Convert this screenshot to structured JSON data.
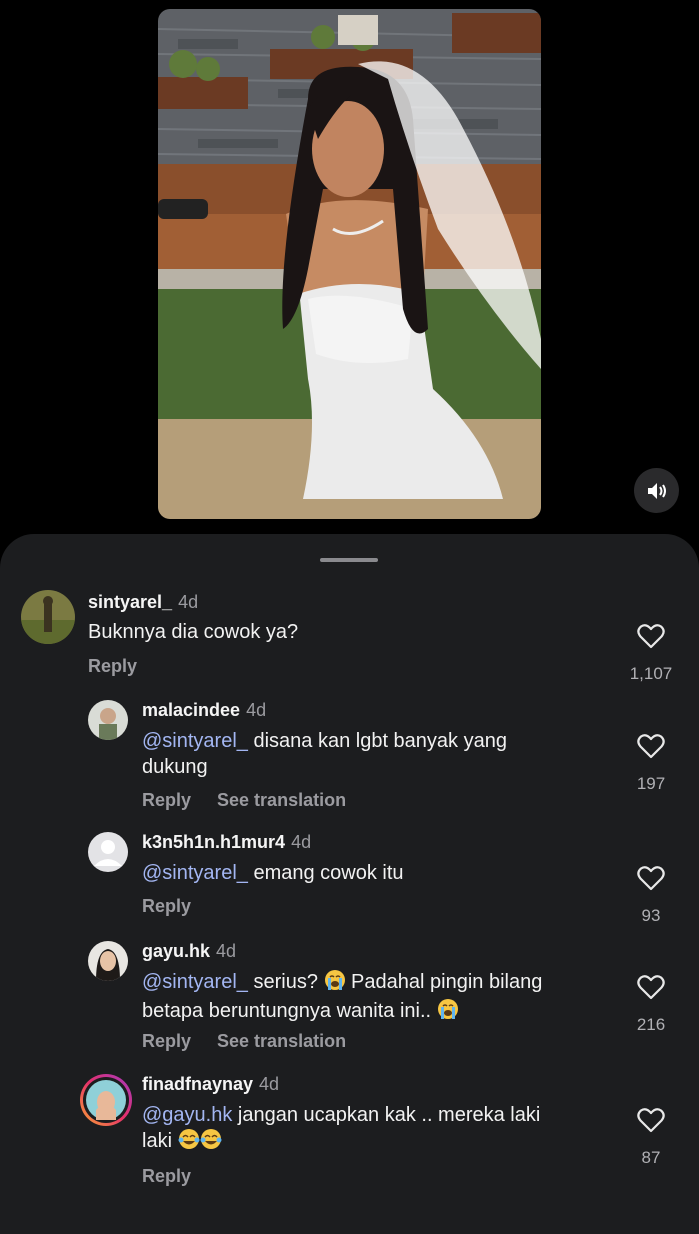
{
  "comments": [
    {
      "username": "sintyarel_",
      "time": "4d",
      "mention": "",
      "text": "Buknnya dia cowok ya?",
      "text2": "",
      "reply": "Reply",
      "translate": "",
      "likes": "1,107"
    },
    {
      "username": "malacindee",
      "time": "4d",
      "mention": "@sintyarel_",
      "text": " disana kan  lgbt banyak yang",
      "text2": "dukung",
      "reply": "Reply",
      "translate": "See translation",
      "likes": "197"
    },
    {
      "username": "k3n5h1n.h1mur4",
      "time": "4d",
      "mention": "@sintyarel_",
      "text": " emang cowok itu",
      "text2": "",
      "reply": "Reply",
      "translate": "",
      "likes": "93"
    },
    {
      "username": "gayu.hk",
      "time": "4d",
      "mention": "@sintyarel_",
      "text": " serius?",
      "text_b": "  Padahal pingin bilang",
      "text2": "betapa beruntungnya wanita ini.. ",
      "reply": "Reply",
      "translate": "See translation",
      "likes": "216"
    },
    {
      "username": "finadfnaynay",
      "time": "4d",
      "mention": "@gayu.hk",
      "text": " jangan ucapkan kak .. mereka laki",
      "text2": "laki ",
      "reply": "Reply",
      "translate": "",
      "likes": "87"
    }
  ],
  "icons": {
    "mute": "speaker-muted-icon",
    "like": "heart-outline-icon",
    "emoji_cry": "loudly-crying-face",
    "emoji_laugh": "face-with-tears-of-joy"
  },
  "colors": {
    "mention": "#a3b6f2",
    "sheet": "#1c1d1f"
  }
}
